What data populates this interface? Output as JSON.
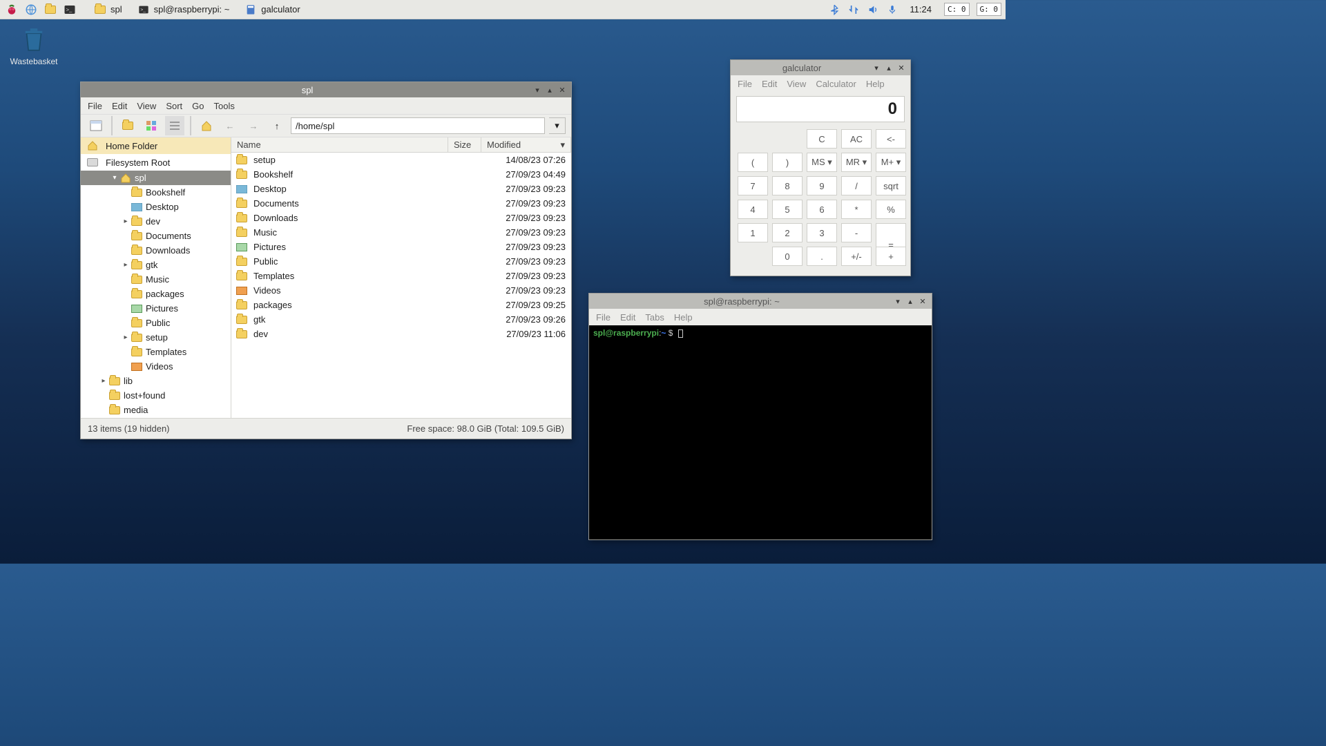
{
  "taskbar": {
    "tasks": [
      {
        "label": "spl",
        "icon": "folder"
      },
      {
        "label": "spl@raspberrypi: ~",
        "icon": "terminal"
      },
      {
        "label": "galculator",
        "icon": "calculator"
      }
    ],
    "clock": "11:24",
    "stats": {
      "cpu": "C:  0",
      "gpu": "G:  0"
    }
  },
  "desktop": {
    "wastebasket": "Wastebasket"
  },
  "filemgr": {
    "title": "spl",
    "menu": [
      "File",
      "Edit",
      "View",
      "Sort",
      "Go",
      "Tools"
    ],
    "path": "/home/spl",
    "sidebar": {
      "home": "Home Folder",
      "fsroot": "Filesystem Root",
      "tree": [
        {
          "depth": 2,
          "expander": "▾",
          "icon": "home",
          "label": "spl",
          "selected": true
        },
        {
          "depth": 3,
          "expander": "",
          "icon": "folder",
          "label": "Bookshelf"
        },
        {
          "depth": 3,
          "expander": "",
          "icon": "desk",
          "label": "Desktop"
        },
        {
          "depth": 3,
          "expander": "▸",
          "icon": "folder",
          "label": "dev"
        },
        {
          "depth": 3,
          "expander": "",
          "icon": "folder",
          "label": "Documents"
        },
        {
          "depth": 3,
          "expander": "",
          "icon": "folder",
          "label": "Downloads"
        },
        {
          "depth": 3,
          "expander": "▸",
          "icon": "folder",
          "label": "gtk"
        },
        {
          "depth": 3,
          "expander": "",
          "icon": "folder",
          "label": "Music"
        },
        {
          "depth": 3,
          "expander": "",
          "icon": "folder",
          "label": "packages"
        },
        {
          "depth": 3,
          "expander": "",
          "icon": "pic",
          "label": "Pictures"
        },
        {
          "depth": 3,
          "expander": "",
          "icon": "folder",
          "label": "Public"
        },
        {
          "depth": 3,
          "expander": "▸",
          "icon": "folder",
          "label": "setup"
        },
        {
          "depth": 3,
          "expander": "",
          "icon": "folder",
          "label": "Templates"
        },
        {
          "depth": 3,
          "expander": "",
          "icon": "vid",
          "label": "Videos"
        },
        {
          "depth": 1,
          "expander": "▸",
          "icon": "folder",
          "label": "lib"
        },
        {
          "depth": 1,
          "expander": "",
          "icon": "folder",
          "label": "lost+found"
        },
        {
          "depth": 1,
          "expander": "",
          "icon": "folder",
          "label": "media"
        }
      ]
    },
    "columns": {
      "name": "Name",
      "size": "Size",
      "modified": "Modified"
    },
    "rows": [
      {
        "icon": "folder",
        "name": "setup",
        "size": "",
        "modified": "14/08/23 07:26"
      },
      {
        "icon": "folder",
        "name": "Bookshelf",
        "size": "",
        "modified": "27/09/23 04:49"
      },
      {
        "icon": "desk",
        "name": "Desktop",
        "size": "",
        "modified": "27/09/23 09:23"
      },
      {
        "icon": "folder",
        "name": "Documents",
        "size": "",
        "modified": "27/09/23 09:23"
      },
      {
        "icon": "folder",
        "name": "Downloads",
        "size": "",
        "modified": "27/09/23 09:23"
      },
      {
        "icon": "folder",
        "name": "Music",
        "size": "",
        "modified": "27/09/23 09:23"
      },
      {
        "icon": "pic",
        "name": "Pictures",
        "size": "",
        "modified": "27/09/23 09:23"
      },
      {
        "icon": "folder",
        "name": "Public",
        "size": "",
        "modified": "27/09/23 09:23"
      },
      {
        "icon": "folder",
        "name": "Templates",
        "size": "",
        "modified": "27/09/23 09:23"
      },
      {
        "icon": "vid",
        "name": "Videos",
        "size": "",
        "modified": "27/09/23 09:23"
      },
      {
        "icon": "folder",
        "name": "packages",
        "size": "",
        "modified": "27/09/23 09:25"
      },
      {
        "icon": "folder",
        "name": "gtk",
        "size": "",
        "modified": "27/09/23 09:26"
      },
      {
        "icon": "folder",
        "name": "dev",
        "size": "",
        "modified": "27/09/23 11:06"
      }
    ],
    "status": {
      "left": "13 items (19 hidden)",
      "right": "Free space: 98.0 GiB (Total: 109.5 GiB)"
    }
  },
  "calc": {
    "title": "galculator",
    "menu": [
      "File",
      "Edit",
      "View",
      "Calculator",
      "Help"
    ],
    "display": "0",
    "rows": [
      [
        "",
        "",
        "C",
        "AC",
        "<-"
      ],
      [
        "(",
        ")",
        "MS ▾",
        "MR ▾",
        "M+ ▾"
      ],
      [
        "7",
        "8",
        "9",
        "/",
        "sqrt"
      ],
      [
        "4",
        "5",
        "6",
        "*",
        "%"
      ],
      [
        "1",
        "2",
        "3",
        "-",
        "="
      ],
      [
        "0",
        ".",
        "+/-",
        "+",
        ""
      ]
    ]
  },
  "term": {
    "title": "spl@raspberrypi: ~",
    "menu": [
      "File",
      "Edit",
      "Tabs",
      "Help"
    ],
    "prompt": {
      "user": "spl@raspberrypi",
      "sep": ":",
      "path": "~",
      "sym": " $ "
    }
  }
}
